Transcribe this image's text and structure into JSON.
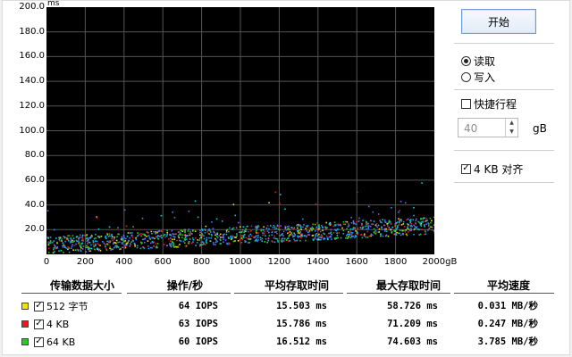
{
  "chart": {
    "unit_y": "ms",
    "y_ticks": [
      "200.0",
      "180.0",
      "160.0",
      "140.0",
      "120.0",
      "100.0",
      "80.0",
      "60.0",
      "40.0",
      "20.0"
    ],
    "x_ticks": [
      "0",
      "200",
      "400",
      "600",
      "800",
      "1000",
      "1200",
      "1400",
      "1600",
      "1800",
      "2000gB"
    ],
    "background": "#000000",
    "grid_color": "#555555"
  },
  "chart_data": {
    "type": "scatter",
    "xlabel": "",
    "ylabel": "ms",
    "xlim": [
      0,
      2000
    ],
    "ylim": [
      0,
      200
    ],
    "grid": true,
    "series": [
      {
        "name": "512 字节",
        "color": "#f2e400",
        "mean_y": 15.5
      },
      {
        "name": "4 KB",
        "color": "#e02020",
        "mean_y": 15.8
      },
      {
        "name": "64 KB",
        "color": "#22cc22",
        "mean_y": 16.5
      }
    ]
  },
  "controls": {
    "start_label": "开始",
    "read_label": "读取",
    "write_label": "写入",
    "quick_seek_label": "快捷行程",
    "spin_value": "40",
    "spin_unit": "gB",
    "align_label": "4 KB 对齐",
    "read_checked": true,
    "quick_seek_checked": false,
    "align_checked": true
  },
  "table": {
    "headers": [
      "传输数据大小",
      "操作/秒",
      "平均存取时间",
      "最大存取时间",
      "平均速度"
    ],
    "rows": [
      {
        "label": "512 字节",
        "color": "#f2e400",
        "ops": "64 IOPS",
        "avg": "15.503 ms",
        "max": "58.726 ms",
        "speed": "0.031 MB/秒"
      },
      {
        "label": "4 KB",
        "color": "#e02020",
        "ops": "63 IOPS",
        "avg": "15.786 ms",
        "max": "71.209 ms",
        "speed": "0.247 MB/秒"
      },
      {
        "label": "64 KB",
        "color": "#22cc22",
        "ops": "60 IOPS",
        "avg": "16.512 ms",
        "max": "74.603 ms",
        "speed": "3.785 MB/秒"
      }
    ]
  }
}
